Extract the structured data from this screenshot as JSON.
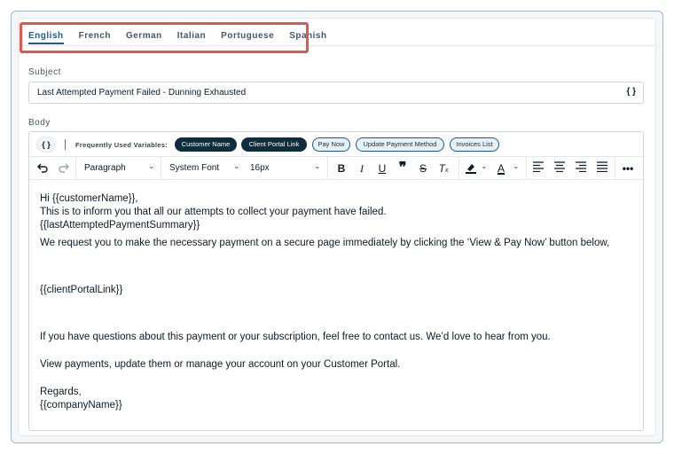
{
  "tabs": [
    "English",
    "French",
    "German",
    "Italian",
    "Portuguese",
    "Spanish"
  ],
  "active_tab": "English",
  "subject": {
    "label": "Subject",
    "value": "Last Attempted Payment Failed - Dunning Exhausted",
    "vars_button": "{ }"
  },
  "body": {
    "label": "Body",
    "vars_button": "{ }",
    "vars_label": "Frequently Used Variables:",
    "chips": [
      {
        "label": "Customer Name",
        "style": "dark"
      },
      {
        "label": "Client Portal Link",
        "style": "dark"
      },
      {
        "label": "Pay Now",
        "style": "light"
      },
      {
        "label": "Update Payment Method",
        "style": "light"
      },
      {
        "label": "Invoices List",
        "style": "light"
      }
    ],
    "toolbar": {
      "paragraph": "Paragraph",
      "font": "System Font",
      "size": "16px"
    },
    "content": {
      "l1": "Hi {{customerName}},",
      "l2": "This is to inform you that all our attempts to collect your payment have failed.",
      "l3": "{{lastAttemptedPaymentSummary}}",
      "l4": "We request you to make the necessary payment on a secure page immediately by clicking the ‘View & Pay Now’ button below,",
      "l5": "{{clientPortalLink}}",
      "l6": "If you have questions about this payment or your subscription, feel free to contact us. We’d love to hear from you.",
      "l7": "View payments, update them or manage your account on your Customer Portal.",
      "l8": "Regards,",
      "l9": "{{companyName}}"
    }
  },
  "colors": {
    "accent": "#1e5a8a",
    "highlight": "#e2574c",
    "chip_dark": "#0f2e3d",
    "chip_light": "#e6f1f7"
  }
}
